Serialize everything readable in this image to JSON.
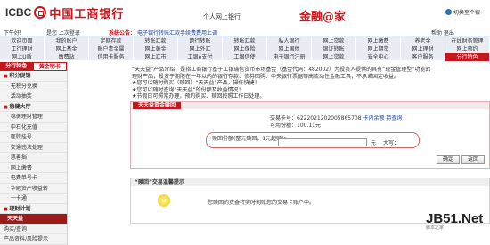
{
  "header": {
    "logo_en": "ICBC",
    "logo_cn": "中国工商银行",
    "slogan": "个人网上银行",
    "brand": "金融@家",
    "exit": "切换至个银"
  },
  "userbar": {
    "user": "下午好！",
    "tail": "是您 上次登录",
    "notice_prefix": "系统公告：",
    "notice_text": "电子银行转账汇款手续费费用上调",
    "links": "帮助 退出"
  },
  "menu": {
    "row1": [
      "欢迎页面",
      "我的账户",
      "定期存款",
      "转账汇款",
      "跨行转账",
      "转账汇款",
      "私人银行",
      "网上贷款",
      "网上缴费",
      "养老金",
      "在线财务管理"
    ],
    "row2": [
      "工行理财",
      "网上基金",
      "账户贵金属",
      "网上黄金",
      "网上外汇",
      "网上保险",
      "网上国债",
      "银证转账",
      "网上期货",
      "网上理财",
      "网上预约"
    ],
    "row3": [
      "网上U盾",
      "缴费站",
      "信用卡服务",
      "网上汇市",
      "工银e支付",
      "工银信使",
      "电子银行注册",
      "网上贷款",
      "安全中心",
      "客户服务",
      "分行特色"
    ],
    "active_row3_index": 10
  },
  "sidebar": {
    "tab_on": "分行特色",
    "tab_off": "黄金明卡",
    "items": [
      {
        "label": "积分促销",
        "kind": "grp"
      },
      {
        "label": "无积分兑换",
        "kind": "sub"
      },
      {
        "label": "活动抽奖",
        "kind": "sub"
      },
      {
        "label": "稳健大厅",
        "kind": "grp"
      },
      {
        "label": "稳健理财管理",
        "kind": "sub"
      },
      {
        "label": "中石化充值",
        "kind": "sub"
      },
      {
        "label": "医院挂号",
        "kind": "sub"
      },
      {
        "label": "交通违法处理",
        "kind": "sub"
      },
      {
        "label": "慈善捐",
        "kind": "sub"
      },
      {
        "label": "网上缴费",
        "kind": "sub"
      },
      {
        "label": "电费单号卡",
        "kind": "sub"
      },
      {
        "label": "华融资产收益转",
        "kind": "sub"
      },
      {
        "label": "一卡通",
        "kind": "sub"
      },
      {
        "label": "理财计划",
        "kind": "grp"
      },
      {
        "label": "天天益",
        "kind": "act"
      },
      {
        "label": "购买/查询",
        "kind": "plain"
      },
      {
        "label": "产品资料/风险提示",
        "kind": "plain"
      }
    ]
  },
  "main": {
    "intro_1": "“天天益”产品介绍：是指工商银行基于工银瑞信货币市场基金（基金代码：482002）为投资人提供的具有“现金管理型”功能的",
    "intro_2": "理财产品，投资于期限在一年以内的银行存款、债券回购、中央银行票据等高流动性金融工具，不承诺固定收益。",
    "intro_3": "★您可以随时购买（赎回）“天天益”产品，操作快捷！",
    "intro_4": "★您可以随时查询“天天益”的份额及收益情况！",
    "intro_5": "★节假日可照常办理，预约购买、赎回按照工作日处理。",
    "panel_title": "天天益资金赎回",
    "card_label": "交易卡号：6222021202005865708",
    "card_link": "卡内余额 持查询",
    "share_label": "可用份额：100.11元",
    "amount_label": "赎回份额(整元赎回，1元起赎)：",
    "unit": "元",
    "cap": "大写：",
    "ok": "确定",
    "back": "返回",
    "tip_title": "“赎回”交易温馨提示",
    "tip_text": "您赎回的资金将实时到账您的交易卡账户中。"
  },
  "watermark": {
    "main": "JB51.Net",
    "sub": "脚本之家"
  }
}
